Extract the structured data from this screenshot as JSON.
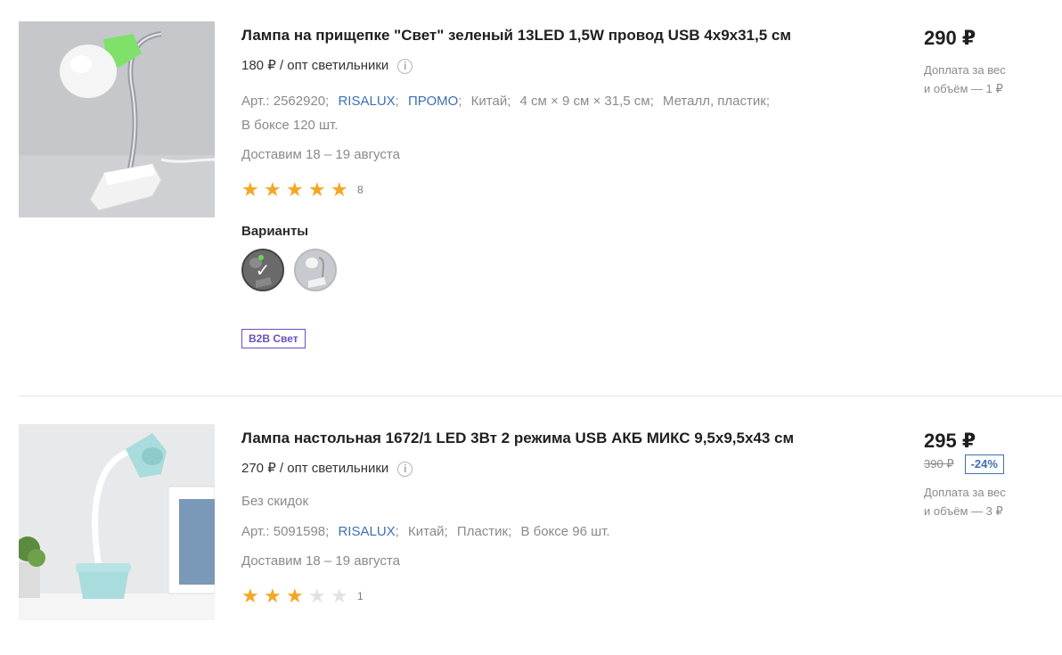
{
  "products": [
    {
      "title": "Лампа на прищепке \"Свет\" зеленый 13LED 1,5W провод USB 4x9x31,5 см",
      "wholesale": "180 ₽ / опт светильники",
      "specs_art": "Арт.: 2562920",
      "brand": "RISALUX",
      "promo": "ПРОМО",
      "country": "Китай",
      "size": "4 см × 9 см × 31,5 см",
      "material": "Металл, пластик",
      "box": "В боксе 120 шт.",
      "delivery": "Доставим 18 – 19 августа",
      "rating": 5,
      "rating_count": "8",
      "variants_label": "Варианты",
      "badge": "B2B Свет",
      "price": "290 ₽",
      "surcharge_line1": "Доплата за вес",
      "surcharge_line2": "и объём — 1 ₽"
    },
    {
      "title": "Лампа настольная 1672/1 LED 3Вт 2 режима USB АКБ МИКС 9,5х9,5х43 см",
      "wholesale": "270 ₽ / опт светильники",
      "no_discount": "Без скидок",
      "specs_art": "Арт.: 5091598",
      "brand": "RISALUX",
      "country": "Китай",
      "material": "Пластик",
      "box": "В боксе 96 шт.",
      "delivery": "Доставим 18 – 19 августа",
      "rating": 3,
      "rating_count": "1",
      "price": "295 ₽",
      "old_price": "390 ₽",
      "discount": "-24%",
      "surcharge_line1": "Доплата за вес",
      "surcharge_line2": "и объём — 3 ₽"
    }
  ],
  "icons": {
    "info": "info-circle-icon",
    "star": "star-icon",
    "check": "checkmark-icon"
  },
  "colors": {
    "link": "#3e70b0",
    "star": "#f5a623",
    "badge": "#6b4fbf"
  }
}
